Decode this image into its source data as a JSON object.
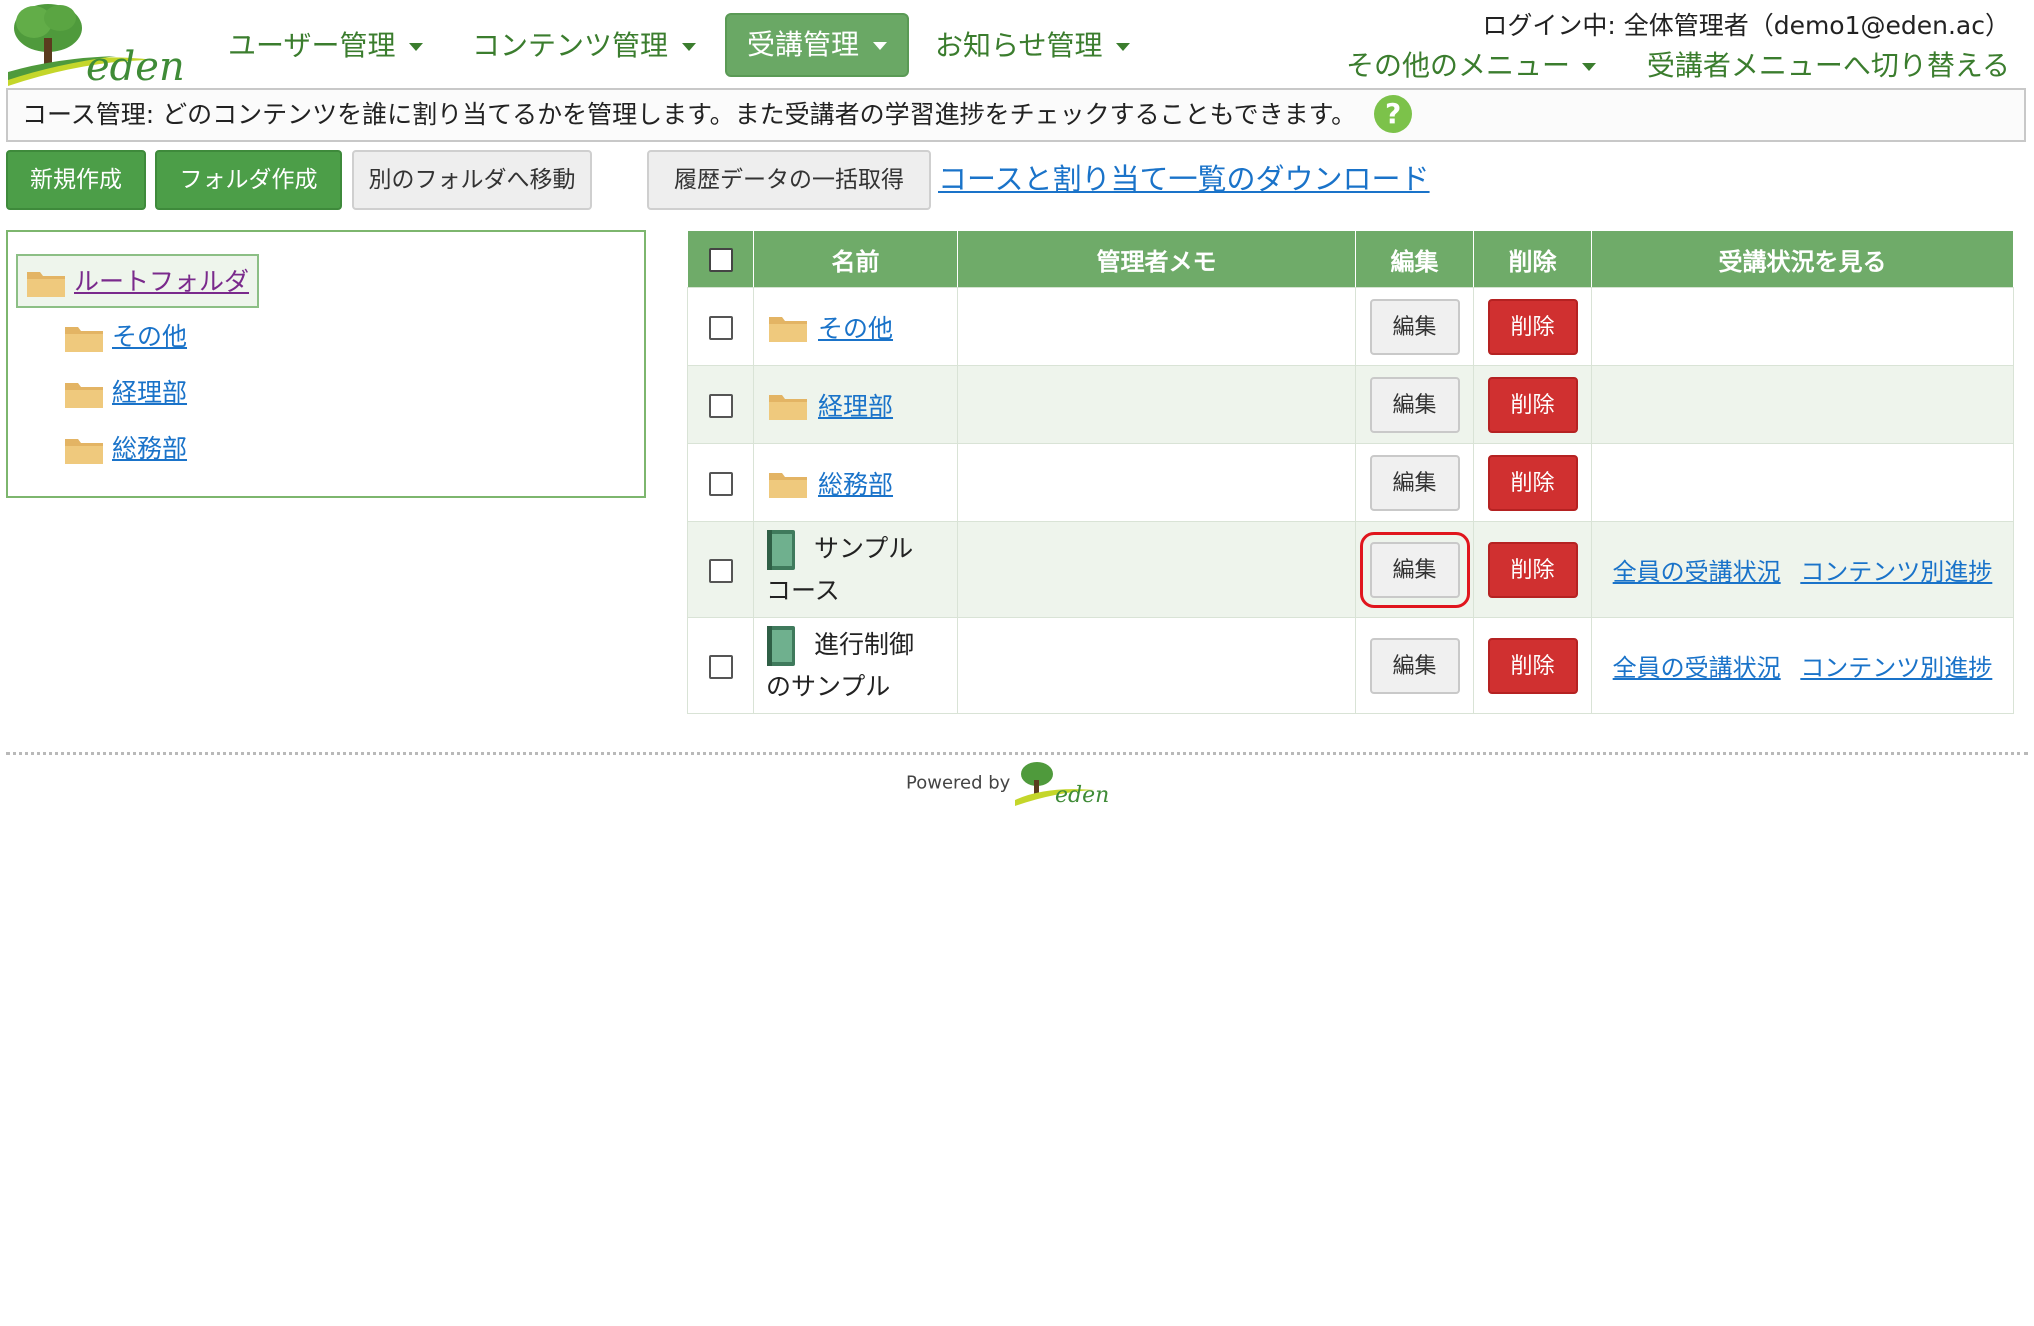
{
  "header": {
    "logo_text": "eden",
    "nav": [
      {
        "label": "ユーザー管理"
      },
      {
        "label": "コンテンツ管理"
      },
      {
        "label": "受講管理",
        "active": true
      },
      {
        "label": "お知らせ管理"
      }
    ],
    "login_text": "ログイン中: 全体管理者（demo1@eden.ac）",
    "other_menu": "その他のメニュー",
    "switch_menu": "受講者メニューへ切り替える"
  },
  "info_bar": {
    "text": "コース管理: どのコンテンツを誰に割り当てるかを管理します。また受講者の学習進捗をチェックすることもできます。",
    "help_icon": "?"
  },
  "toolbar": {
    "new_label": "新規作成",
    "folder_label": "フォルダ作成",
    "move_label": "別のフォルダへ移動",
    "history_label": "履歴データの一括取得",
    "download_link": "コースと割り当て一覧のダウンロード"
  },
  "tree": {
    "root": "ルートフォルダ",
    "children": [
      "その他",
      "経理部",
      "総務部"
    ]
  },
  "table": {
    "headers": {
      "name": "名前",
      "memo": "管理者メモ",
      "edit": "編集",
      "delete": "削除",
      "status": "受講状況を見る"
    },
    "edit_label": "編集",
    "delete_label": "削除",
    "all_status_label": "全員の受講状況",
    "per_content_label": "コンテンツ別進捗",
    "rows": [
      {
        "type": "folder",
        "name": "その他"
      },
      {
        "type": "folder",
        "name": "経理部"
      },
      {
        "type": "folder",
        "name": "総務部"
      },
      {
        "type": "course",
        "name_line1": "サンプル",
        "name_line2": "コース"
      },
      {
        "type": "course",
        "name_line1": "進行制御",
        "name_line2": "のサンプル"
      }
    ]
  },
  "footer": {
    "powered_by": "Powered by",
    "logo_text": "eden"
  },
  "colors": {
    "brand_green": "#4c9e48",
    "header_green": "#6fab69",
    "delete_red": "#d03030",
    "link_blue": "#1a73c9",
    "highlight_red": "#e0161d"
  }
}
